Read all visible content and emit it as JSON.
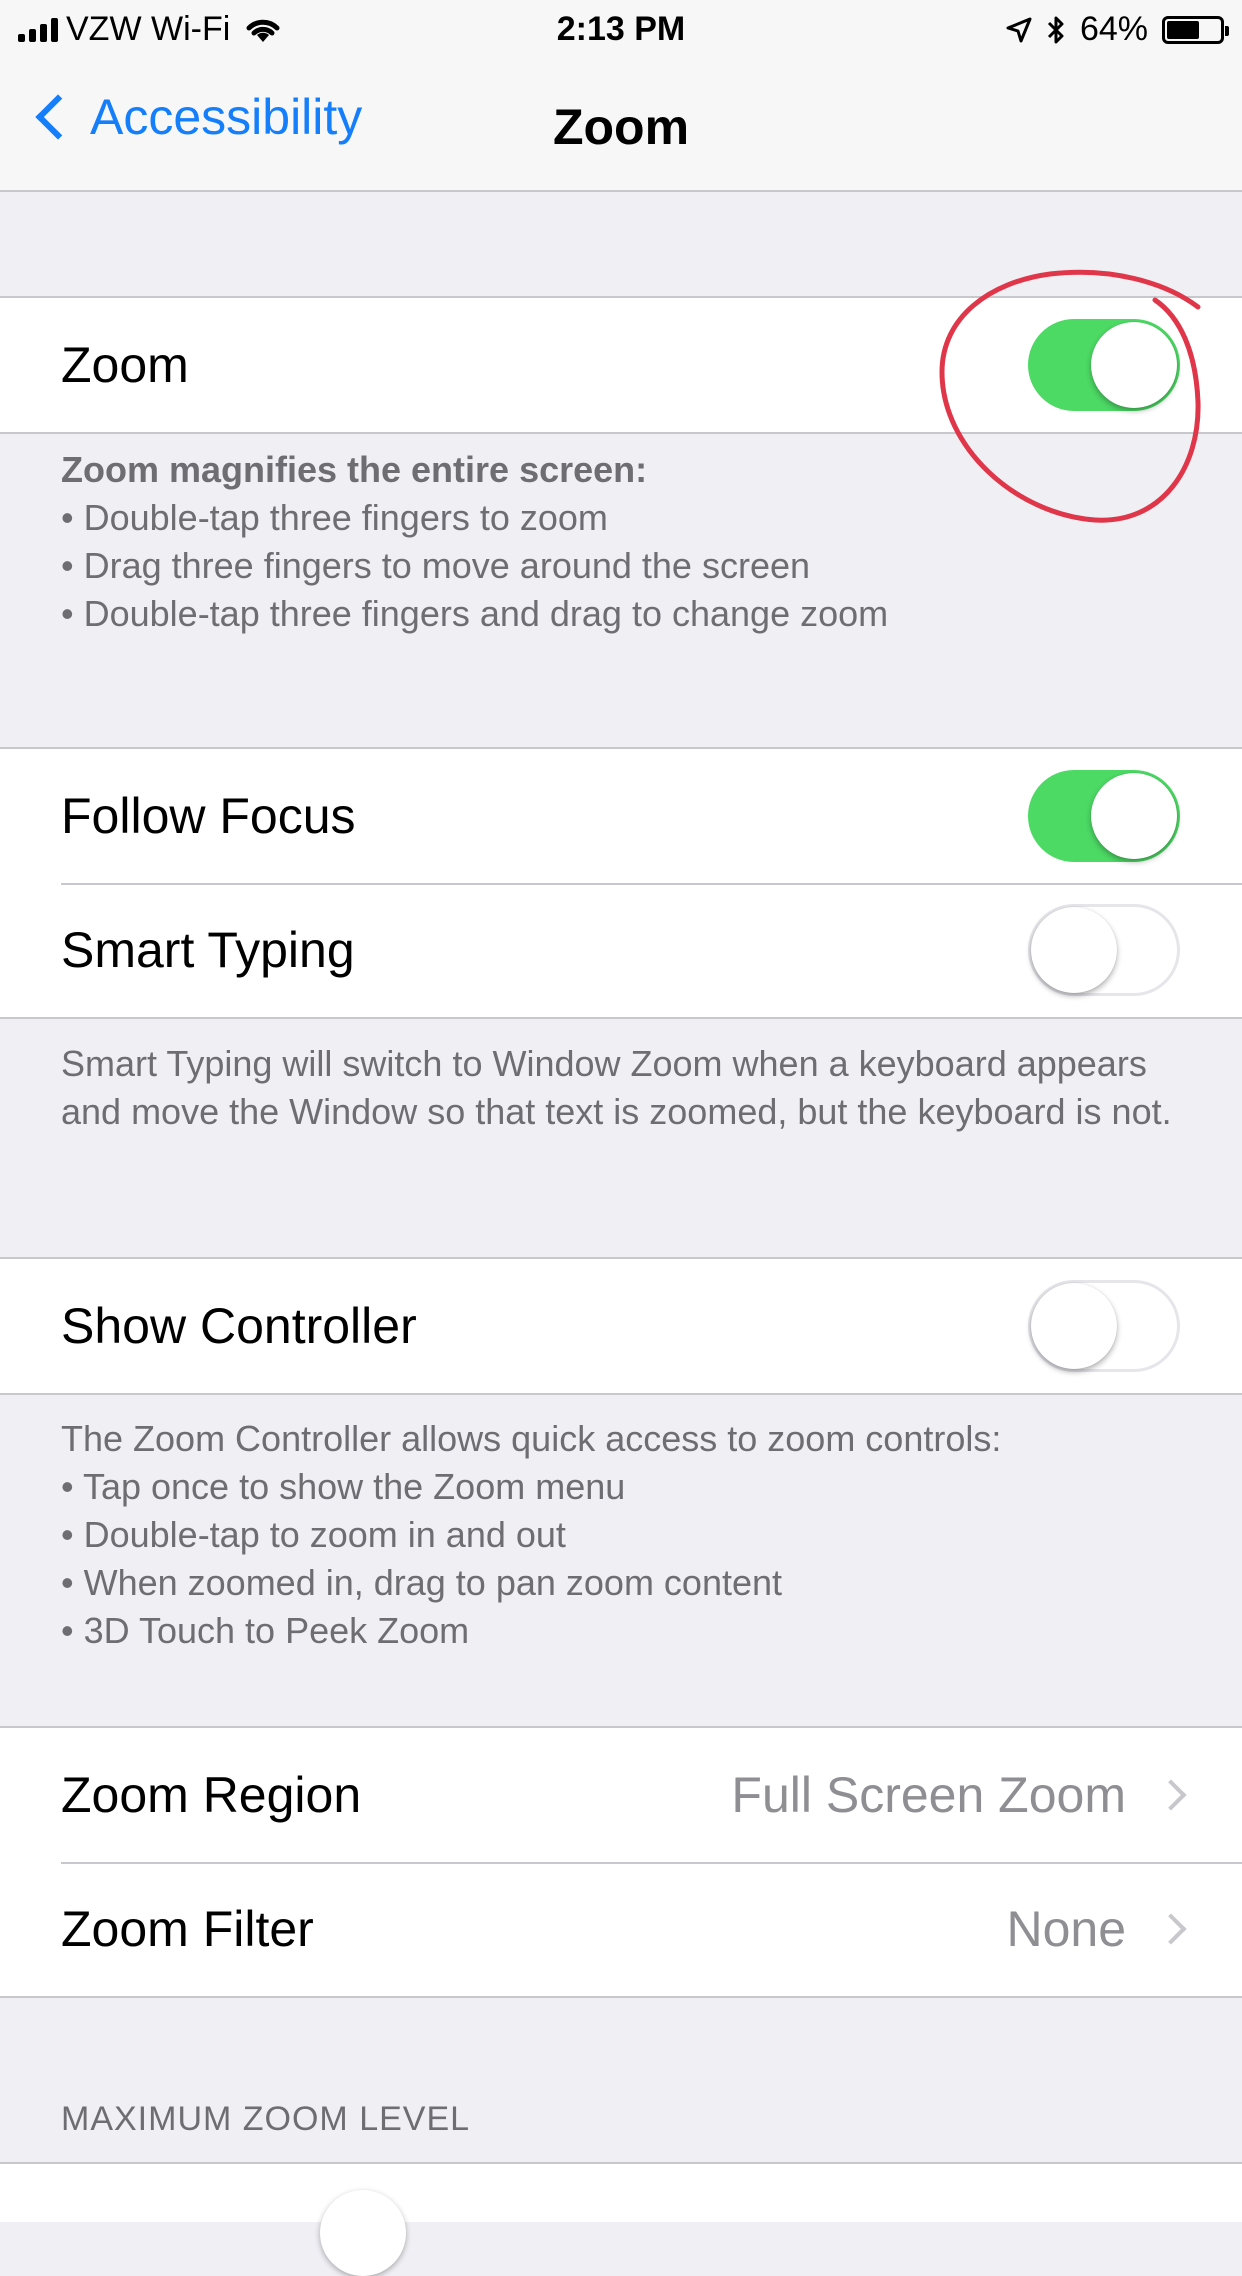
{
  "status_bar": {
    "carrier": "VZW Wi-Fi",
    "time": "2:13 PM",
    "battery_percent": "64%",
    "battery_level": 0.64,
    "icons": [
      "signal-icon",
      "wifi-icon",
      "location-icon",
      "bluetooth-icon",
      "battery-icon"
    ]
  },
  "nav": {
    "back_label": "Accessibility",
    "title": "Zoom"
  },
  "zoom": {
    "label": "Zoom",
    "enabled": true
  },
  "zoom_footer": {
    "title": "Zoom magnifies the entire screen:",
    "bullets": [
      "• Double-tap three fingers to zoom",
      "• Drag three fingers to move around the screen",
      "• Double-tap three fingers and drag to change zoom"
    ]
  },
  "follow_focus": {
    "label": "Follow Focus",
    "enabled": true
  },
  "smart_typing": {
    "label": "Smart Typing",
    "enabled": false
  },
  "smart_typing_footer": {
    "text": "Smart Typing will switch to Window Zoom when a keyboard appears and move the Window so that text is zoomed, but the keyboard is not."
  },
  "show_controller": {
    "label": "Show Controller",
    "enabled": false
  },
  "controller_footer": {
    "title": "The Zoom Controller allows quick access to zoom controls:",
    "bullets": [
      "• Tap once to show the Zoom menu",
      "• Double-tap to zoom in and out",
      "• When zoomed in, drag to pan zoom content",
      "• 3D Touch to Peek Zoom"
    ]
  },
  "zoom_region": {
    "label": "Zoom Region",
    "value": "Full Screen Zoom"
  },
  "zoom_filter": {
    "label": "Zoom Filter",
    "value": "None"
  },
  "max_zoom_header": "MAXIMUM ZOOM LEVEL",
  "colors": {
    "accent": "#157efb",
    "switch_on": "#4cd964",
    "annotation": "#e0364a"
  }
}
